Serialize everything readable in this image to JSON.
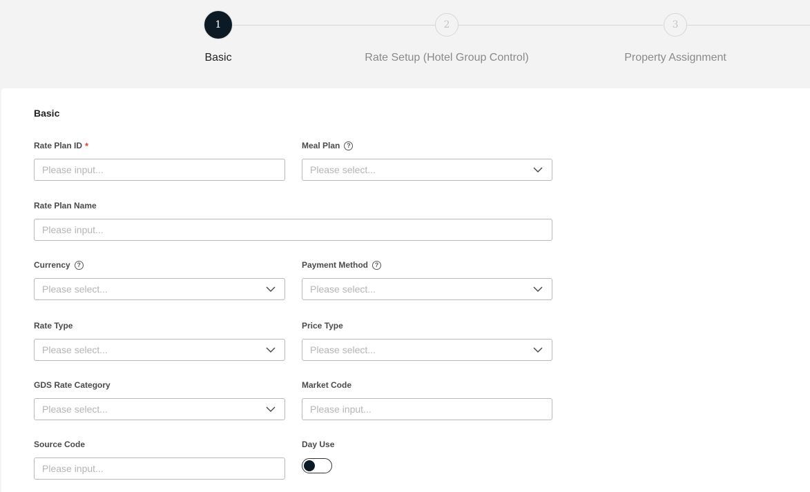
{
  "stepper": {
    "steps": [
      {
        "number": "1",
        "label": "Basic"
      },
      {
        "number": "2",
        "label": "Rate Setup (Hotel Group Control)"
      },
      {
        "number": "3",
        "label": "Property Assignment"
      }
    ],
    "active_step": 1
  },
  "form": {
    "section_title": "Basic",
    "input_placeholder": "Please input...",
    "select_placeholder": "Please select...",
    "fields": {
      "rate_plan_id": {
        "label": "Rate Plan ID",
        "required": "*"
      },
      "meal_plan": {
        "label": "Meal Plan"
      },
      "rate_plan_name": {
        "label": "Rate Plan Name"
      },
      "currency": {
        "label": "Currency"
      },
      "payment_method": {
        "label": "Payment Method"
      },
      "rate_type": {
        "label": "Rate Type"
      },
      "price_type": {
        "label": "Price Type"
      },
      "gds_rate_category": {
        "label": "GDS Rate Category"
      },
      "market_code": {
        "label": "Market Code"
      },
      "source_code": {
        "label": "Source Code"
      },
      "day_use": {
        "label": "Day Use",
        "enabled": false
      }
    },
    "help_glyph": "?"
  },
  "colors": {
    "active_step": "#0c1a26",
    "required": "#e23b3b",
    "placeholder": "#b5b5b5"
  }
}
